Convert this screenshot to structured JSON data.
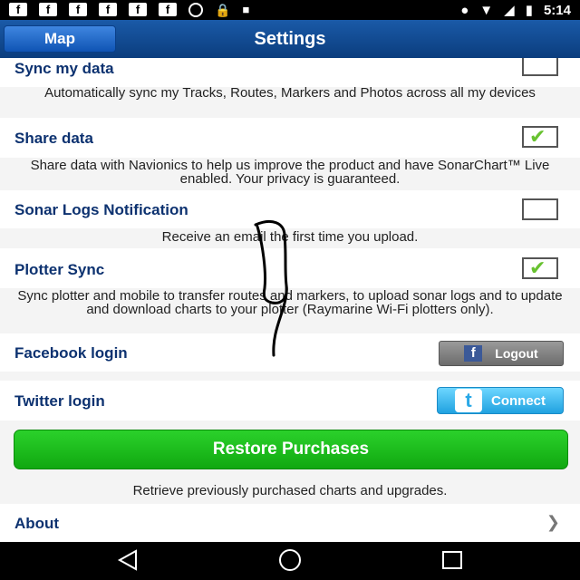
{
  "status_bar": {
    "left_icons": [
      "f",
      "f",
      "f",
      "f",
      "f",
      "f",
      "cake",
      "lock",
      "android"
    ],
    "time": "5:14"
  },
  "navbar": {
    "back_label": "Map",
    "title": "Settings"
  },
  "settings": {
    "sync": {
      "label": "Sync my data",
      "checked": false,
      "description": "Automatically sync my Tracks, Routes, Markers and Photos across all my devices"
    },
    "share": {
      "label": "Share data",
      "checked": true,
      "description": "Share data with Navionics to help us improve the product and have SonarChart™ Live enabled. Your privacy is guaranteed."
    },
    "sonar": {
      "label": "Sonar Logs Notification",
      "checked": false,
      "description": "Receive an email the first time you upload."
    },
    "plotter": {
      "label": "Plotter Sync",
      "checked": true,
      "description": "Sync plotter and mobile to transfer routes and markers, to upload sonar logs and to update and download charts to your plotter (Raymarine Wi-Fi plotters only)."
    },
    "facebook": {
      "label": "Facebook login",
      "button": "Logout"
    },
    "twitter": {
      "label": "Twitter login",
      "button": "Connect"
    },
    "restore": {
      "button": "Restore Purchases",
      "description": "Retrieve previously purchased charts and upgrades."
    },
    "about": {
      "label": "About"
    }
  },
  "colors": {
    "nav": "#0b3d7e",
    "label": "#0d3270",
    "check": "#68c230",
    "restore": "#10a810",
    "twitter": "#20a2e0",
    "facebook": "#3b5998"
  }
}
